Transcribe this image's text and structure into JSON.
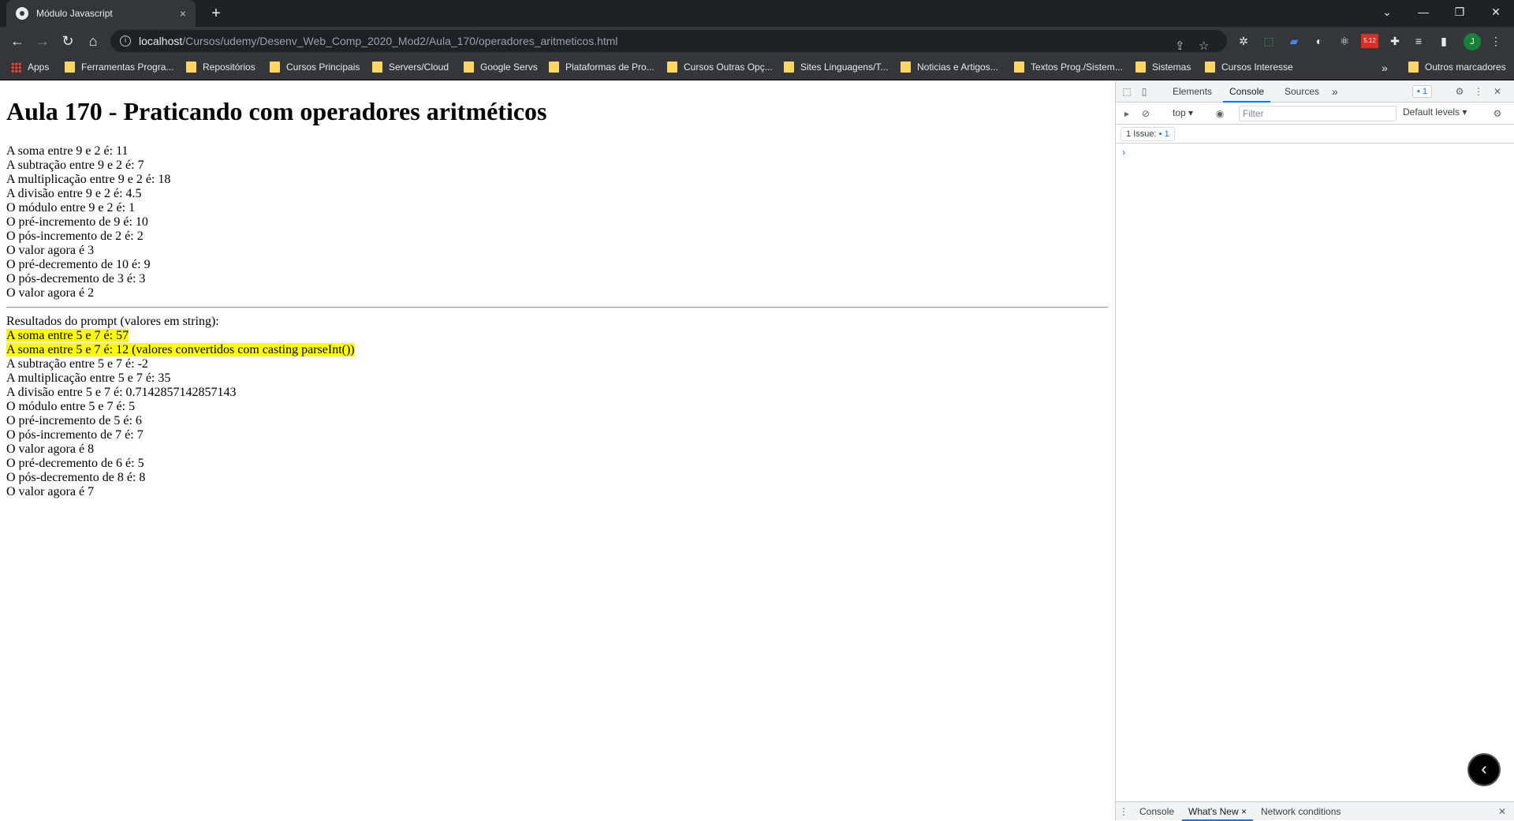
{
  "browser": {
    "tab_title": "Módulo Javascript",
    "tab_close": "×",
    "new_tab": "+",
    "window_controls": [
      "⌄",
      "—",
      "❐",
      "✕"
    ],
    "url_host": "localhost",
    "url_path": "/Cursos/udemy/Desenv_Web_Comp_2020_Mod2/Aula_170/operadores_aritmeticos.html",
    "avatar_letter": "J",
    "extension_badge": "5.12",
    "bookmarks": [
      "Apps",
      "Ferramentas Progra...",
      "Repositórios",
      "Cursos Principais",
      "Servers/Cloud",
      "Google Servs",
      "Plataformas de Pro...",
      "Cursos Outras Opç...",
      "Sites Linguagens/T...",
      "Noticias e Artigos...",
      "Textos Prog./Sistem...",
      "Sistemas",
      "Cursos Interesse"
    ],
    "bookmarks_overflow": "»",
    "other_bookmarks": "Outros marcadores"
  },
  "page": {
    "heading": "Aula 170 - Praticando com operadores aritméticos",
    "section1": [
      "A soma entre 9 e 2 é: 11",
      "A subtração entre 9 e 2 é: 7",
      "A multiplicação entre 9 e 2 é: 18",
      "A divisão entre 9 e 2 é: 4.5",
      "O módulo entre 9 e 2 é: 1",
      "O pré-incremento de 9 é: 10",
      "O pós-incremento de 2 é: 2",
      "O valor agora é 3",
      "O pré-decremento de 10 é: 9",
      "O pós-decremento de 3 é: 3",
      "O valor agora é 2"
    ],
    "section2_title": "Resultados do prompt (valores em string):",
    "section2_highlight": [
      "A soma entre 5 e 7 é: 57",
      "A soma entre 5 e 7 é: 12 (valores convertidos com casting parseInt())"
    ],
    "section2": [
      "A subtração entre 5 e 7 é: -2",
      "A multiplicação entre 5 e 7 é: 35",
      "A divisão entre 5 e 7 é: 0.7142857142857143",
      "O módulo entre 5 e 7 é: 5",
      "O pré-incremento de 5 é: 6",
      "O pós-incremento de 7 é: 7",
      "O valor agora é 8",
      "O pré-decremento de 6 é: 5",
      "O pós-decremento de 8 é: 8",
      "O valor agora é 7"
    ]
  },
  "devtools": {
    "tabs": [
      "Elements",
      "Console",
      "Sources"
    ],
    "active_tab": "Console",
    "more_tabs": "»",
    "issues_badge": "1",
    "context": "top",
    "filter_placeholder": "Filter",
    "levels": "Default levels",
    "issues_label": "1 Issue:",
    "issues_count": "1",
    "prompt": "›",
    "drawer_tabs": [
      "Console",
      "What's New",
      "Network conditions"
    ],
    "drawer_active": "What's New",
    "drawer_close": "×",
    "fab": "‹"
  },
  "colors": {
    "highlight": "#ffff00",
    "chrome_dark": "#202124",
    "accent": "#1a73e8"
  }
}
